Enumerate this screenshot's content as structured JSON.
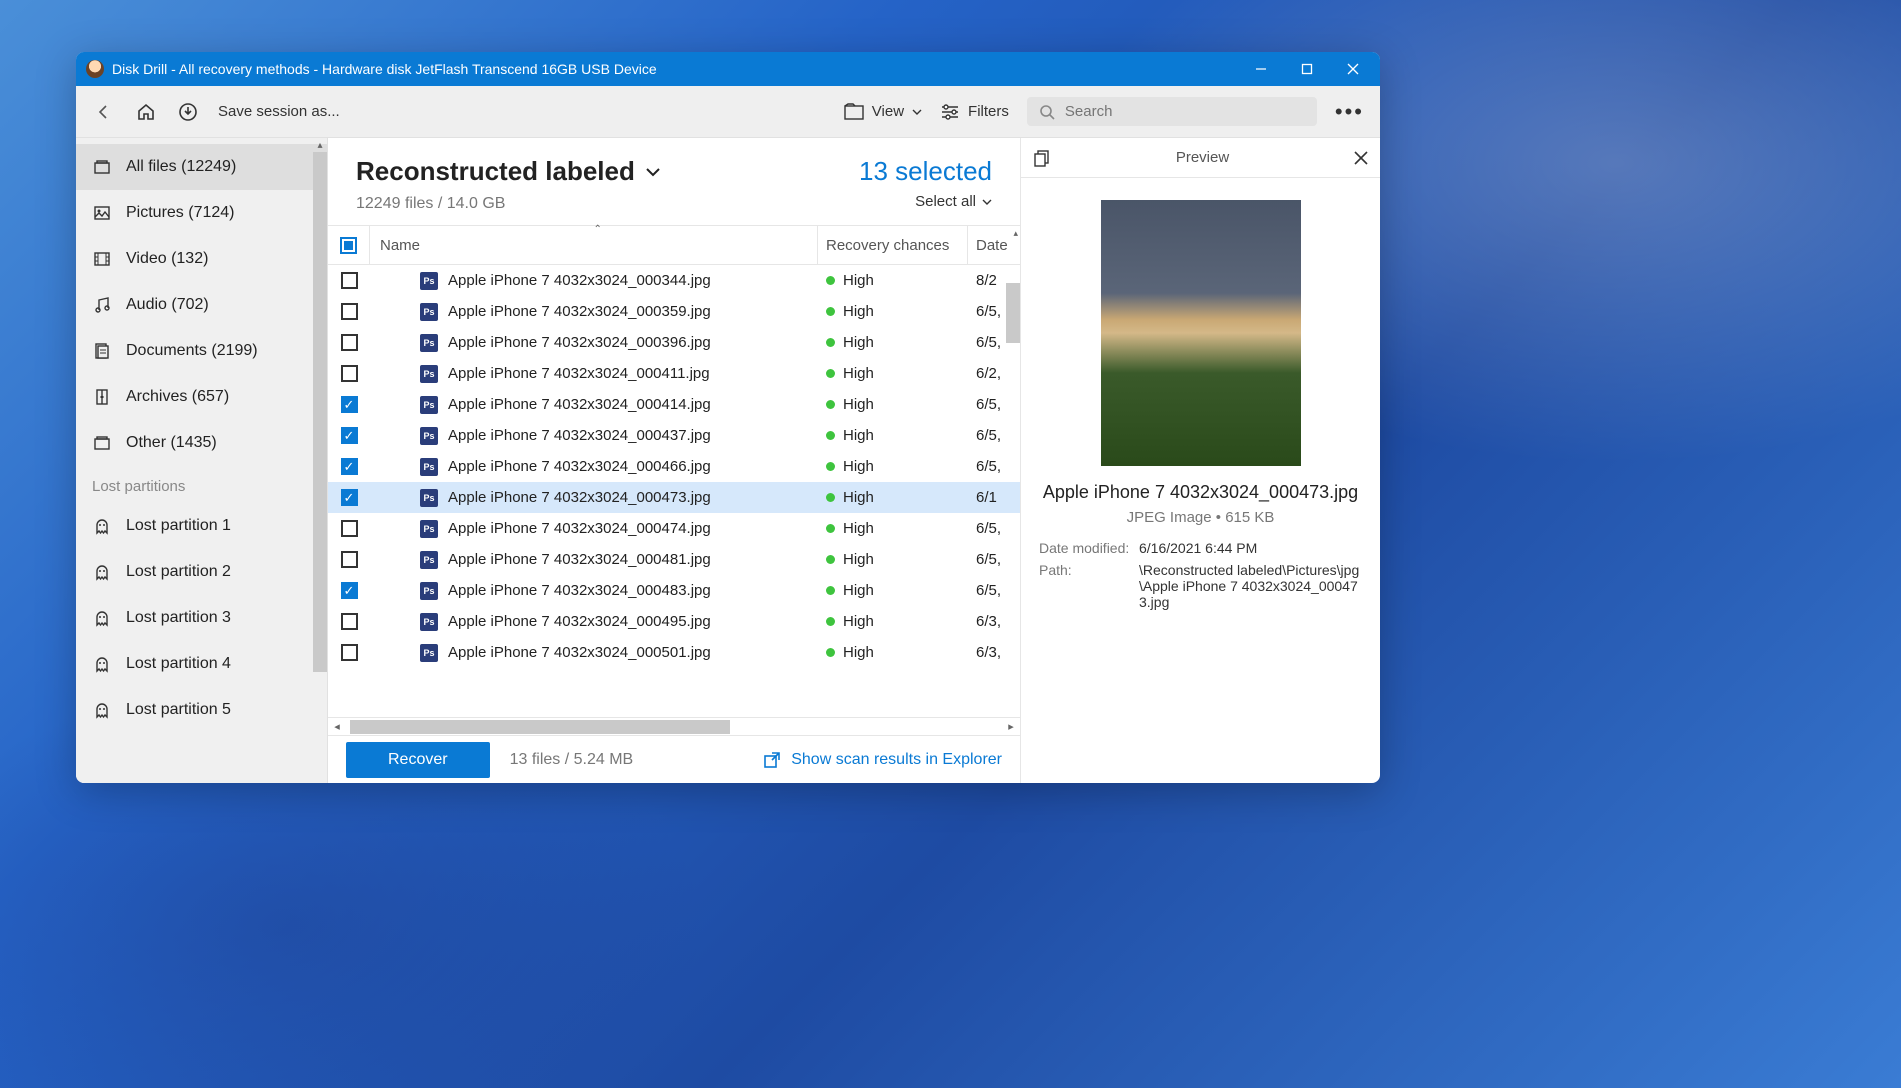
{
  "titlebar": {
    "title": "Disk Drill - All recovery methods - Hardware disk JetFlash Transcend 16GB USB Device"
  },
  "toolbar": {
    "save_session": "Save session as...",
    "view": "View",
    "filters": "Filters",
    "search_placeholder": "Search"
  },
  "sidebar": {
    "items": [
      {
        "label": "All files (12249)"
      },
      {
        "label": "Pictures (7124)"
      },
      {
        "label": "Video (132)"
      },
      {
        "label": "Audio (702)"
      },
      {
        "label": "Documents (2199)"
      },
      {
        "label": "Archives (657)"
      },
      {
        "label": "Other (1435)"
      }
    ],
    "lost_header": "Lost partitions",
    "lost": [
      {
        "label": "Lost partition 1"
      },
      {
        "label": "Lost partition 2"
      },
      {
        "label": "Lost partition 3"
      },
      {
        "label": "Lost partition 4"
      },
      {
        "label": "Lost partition 5"
      }
    ]
  },
  "main": {
    "heading": "Reconstructed labeled",
    "sub": "12249 files / 14.0 GB",
    "selected": "13 selected",
    "select_all": "Select all",
    "columns": {
      "name": "Name",
      "recovery": "Recovery chances",
      "date": "Date"
    },
    "files": [
      {
        "name": "Apple iPhone 7 4032x3024_000344.jpg",
        "rec": "High",
        "date": "8/2",
        "checked": false
      },
      {
        "name": "Apple iPhone 7 4032x3024_000359.jpg",
        "rec": "High",
        "date": "6/5,",
        "checked": false
      },
      {
        "name": "Apple iPhone 7 4032x3024_000396.jpg",
        "rec": "High",
        "date": "6/5,",
        "checked": false
      },
      {
        "name": "Apple iPhone 7 4032x3024_000411.jpg",
        "rec": "High",
        "date": "6/2,",
        "checked": false
      },
      {
        "name": "Apple iPhone 7 4032x3024_000414.jpg",
        "rec": "High",
        "date": "6/5,",
        "checked": true
      },
      {
        "name": "Apple iPhone 7 4032x3024_000437.jpg",
        "rec": "High",
        "date": "6/5,",
        "checked": true
      },
      {
        "name": "Apple iPhone 7 4032x3024_000466.jpg",
        "rec": "High",
        "date": "6/5,",
        "checked": true
      },
      {
        "name": "Apple iPhone 7 4032x3024_000473.jpg",
        "rec": "High",
        "date": "6/1",
        "checked": true,
        "selected": true
      },
      {
        "name": "Apple iPhone 7 4032x3024_000474.jpg",
        "rec": "High",
        "date": "6/5,",
        "checked": false
      },
      {
        "name": "Apple iPhone 7 4032x3024_000481.jpg",
        "rec": "High",
        "date": "6/5,",
        "checked": false
      },
      {
        "name": "Apple iPhone 7 4032x3024_000483.jpg",
        "rec": "High",
        "date": "6/5,",
        "checked": true
      },
      {
        "name": "Apple iPhone 7 4032x3024_000495.jpg",
        "rec": "High",
        "date": "6/3,",
        "checked": false
      },
      {
        "name": "Apple iPhone 7 4032x3024_000501.jpg",
        "rec": "High",
        "date": "6/3,",
        "checked": false
      }
    ]
  },
  "footer": {
    "recover": "Recover",
    "summary": "13 files / 5.24 MB",
    "explorer": "Show scan results in Explorer"
  },
  "preview": {
    "title": "Preview",
    "filename": "Apple iPhone 7 4032x3024_000473.jpg",
    "type": "JPEG Image • 615 KB",
    "date_label": "Date modified:",
    "date_value": "6/16/2021 6:44 PM",
    "path_label": "Path:",
    "path_value": "\\Reconstructed labeled\\Pictures\\jpg\\Apple iPhone 7 4032x3024_000473.jpg"
  }
}
